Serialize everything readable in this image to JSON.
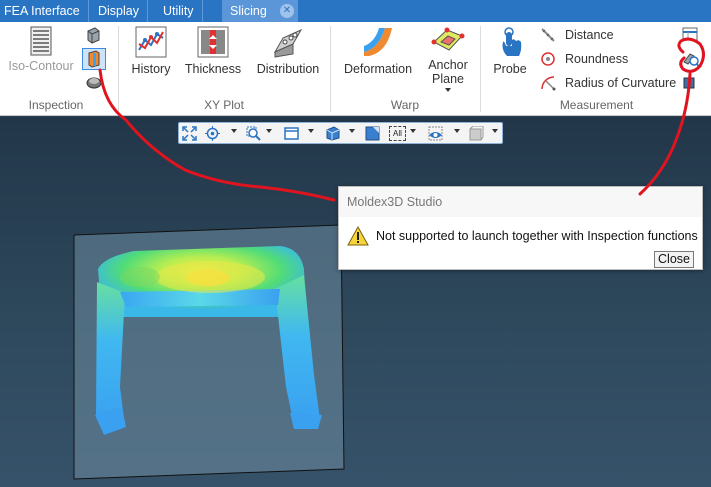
{
  "tabs": [
    {
      "label": "FEA Interface",
      "active": false
    },
    {
      "label": "Display",
      "active": false
    },
    {
      "label": "Utility",
      "active": false
    },
    {
      "label": "Slicing",
      "active": true
    }
  ],
  "ribbon": {
    "inspection": {
      "group_label": "Inspection",
      "iso_contour_label": "Iso-Contour"
    },
    "xyplot": {
      "group_label": "XY Plot",
      "history_label": "History",
      "thickness_label": "Thickness",
      "distribution_label": "Distribution"
    },
    "warp": {
      "group_label": "Warp",
      "deformation_label": "Deformation",
      "anchor_plane_label_1": "Anchor",
      "anchor_plane_label_2": "Plane"
    },
    "measurement": {
      "group_label": "Measurement",
      "probe_label": "Probe",
      "distance_label": "Distance",
      "roundness_label": "Roundness",
      "radius_label": "Radius of Curvature"
    }
  },
  "toolbar3d": {
    "all_label": "All"
  },
  "dialog": {
    "title": "Moldex3D Studio",
    "message": "Not supported to launch together with Inspection functions",
    "close_label": "Close"
  },
  "colors": {
    "tab_bar": "#2a74c4",
    "tab_active": "#5b97d8",
    "annotation_red": "#e0141e",
    "viewport_dark": "#223649",
    "part_blue": "#3aa0f0",
    "part_green": "#54e070",
    "part_yellow": "#f2ee40"
  }
}
